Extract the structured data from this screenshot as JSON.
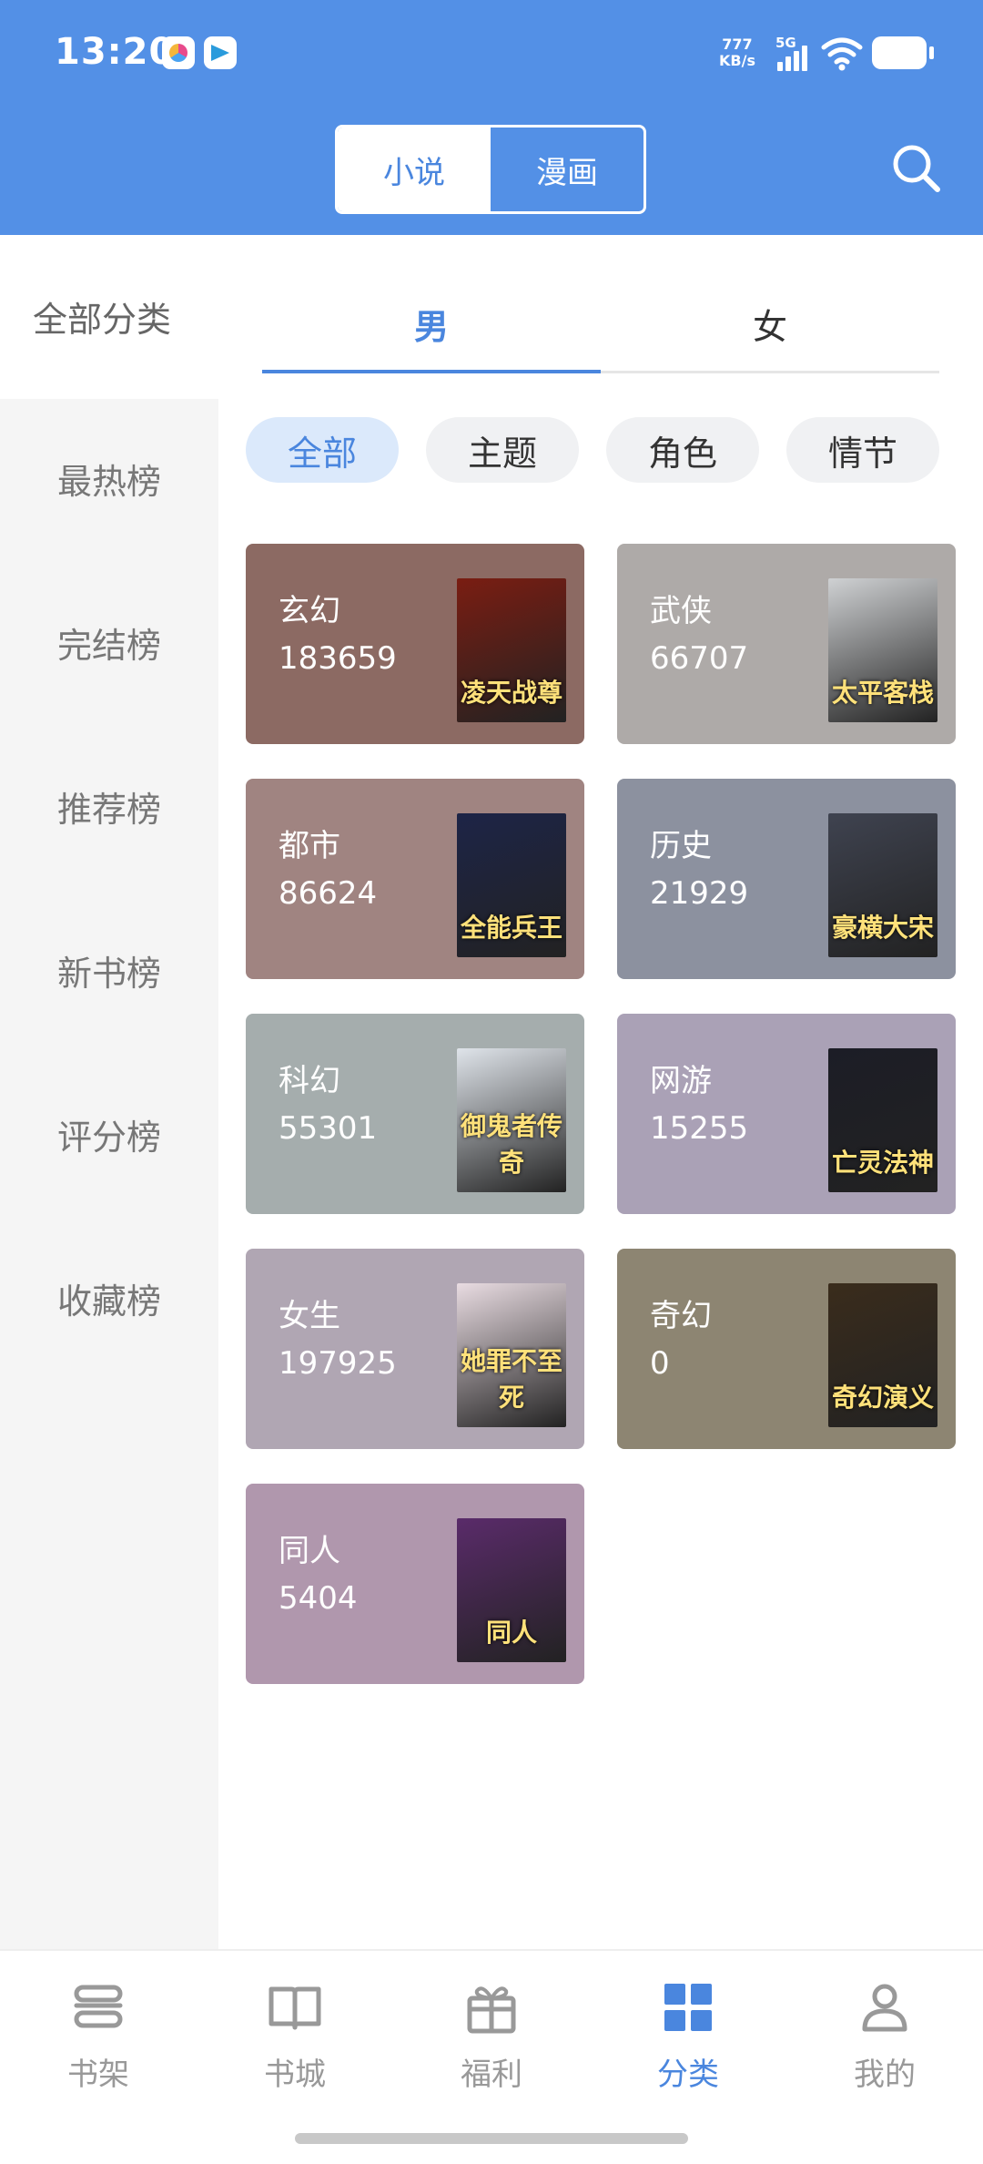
{
  "status_bar": {
    "time": "13:20",
    "net_speed_value": "777",
    "net_speed_unit": "KB/s",
    "signal_label": "5G"
  },
  "header": {
    "tabs": [
      "小说",
      "漫画"
    ],
    "active_tab": "小说",
    "search_icon": "search-icon"
  },
  "category_title": "全部分类",
  "gender_tabs": [
    "男",
    "女"
  ],
  "active_gender": "男",
  "left_nav": [
    "最热榜",
    "完结榜",
    "推荐榜",
    "新书榜",
    "评分榜",
    "收藏榜"
  ],
  "filter_chips": [
    "全部",
    "主题",
    "角色",
    "情节"
  ],
  "active_chip": "全部",
  "categories": [
    {
      "name": "玄幻",
      "count": "183659",
      "color": "#8c6a63",
      "cover_title": "凌天战尊",
      "cover_color": "#7a1d12"
    },
    {
      "name": "武侠",
      "count": "66707",
      "color": "#aeaaa8",
      "cover_title": "太平客栈",
      "cover_color": "#cfd1d3"
    },
    {
      "name": "都市",
      "count": "86624",
      "color": "#a08481",
      "cover_title": "全能兵王",
      "cover_color": "#1d2447"
    },
    {
      "name": "历史",
      "count": "21929",
      "color": "#8c919f",
      "cover_title": "豪横大宋",
      "cover_color": "#3f4350"
    },
    {
      "name": "科幻",
      "count": "55301",
      "color": "#a5adad",
      "cover_title": "御鬼者传奇",
      "cover_color": "#dfe4ea"
    },
    {
      "name": "网游",
      "count": "15255",
      "color": "#aaa1b6",
      "cover_title": "亡灵法神",
      "cover_color": "#1c1d26"
    },
    {
      "name": "女生",
      "count": "197925",
      "color": "#b0a6b3",
      "cover_title": "她罪不至死",
      "cover_color": "#e9dce2"
    },
    {
      "name": "奇幻",
      "count": "0",
      "color": "#8d8572",
      "cover_title": "奇幻演义",
      "cover_color": "#3a2c1c"
    },
    {
      "name": "同人",
      "count": "5404",
      "color": "#b097ad",
      "cover_title": "同人",
      "cover_color": "#5a2b6a"
    }
  ],
  "bottom_nav": [
    {
      "label": "书架",
      "icon": "bookshelf-icon"
    },
    {
      "label": "书城",
      "icon": "book-icon"
    },
    {
      "label": "福利",
      "icon": "gift-icon"
    },
    {
      "label": "分类",
      "icon": "category-grid-icon"
    },
    {
      "label": "我的",
      "icon": "profile-icon"
    }
  ],
  "active_bottom": "分类",
  "colors": {
    "primary": "#5390e6",
    "accent": "#4a86de"
  }
}
